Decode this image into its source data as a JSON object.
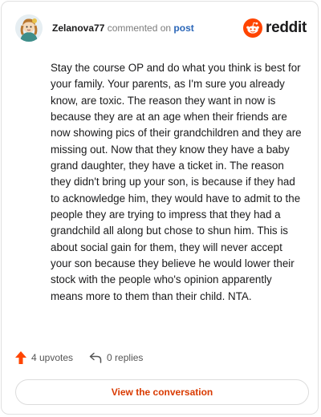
{
  "header": {
    "username": "Zelanova77",
    "action_text": " commented on ",
    "post_link": "post",
    "brand_name": "reddit"
  },
  "comment": {
    "body": "Stay the course OP and do what you think is best for your family. Your parents, as I'm sure you already know, are toxic. The reason they want in now is because they are at an age when their friends are now showing pics of their grandchildren and they are missing out. Now that they know they have a baby grand daughter, they have a ticket in. The reason they didn't bring up your son, is because if they had to acknowledge him, they would have to admit to the people they are trying to impress that they had a grandchild all along but chose to shun him. This is about social gain for them, they will never accept your son because they believe he would lower their stock with the people who's opinion apparently means more to them than their child. NTA."
  },
  "actions": {
    "upvotes": "4 upvotes",
    "replies": "0 replies"
  },
  "cta": {
    "label": "View the conversation"
  },
  "icons": {
    "avatar": "user-avatar",
    "brand": "reddit-logo-icon",
    "upvote": "upvote-arrow-icon",
    "reply": "reply-arrow-icon"
  },
  "colors": {
    "brand_orange": "#FF4500",
    "link_blue": "#2A66B8",
    "cta_text": "#D93A00"
  }
}
